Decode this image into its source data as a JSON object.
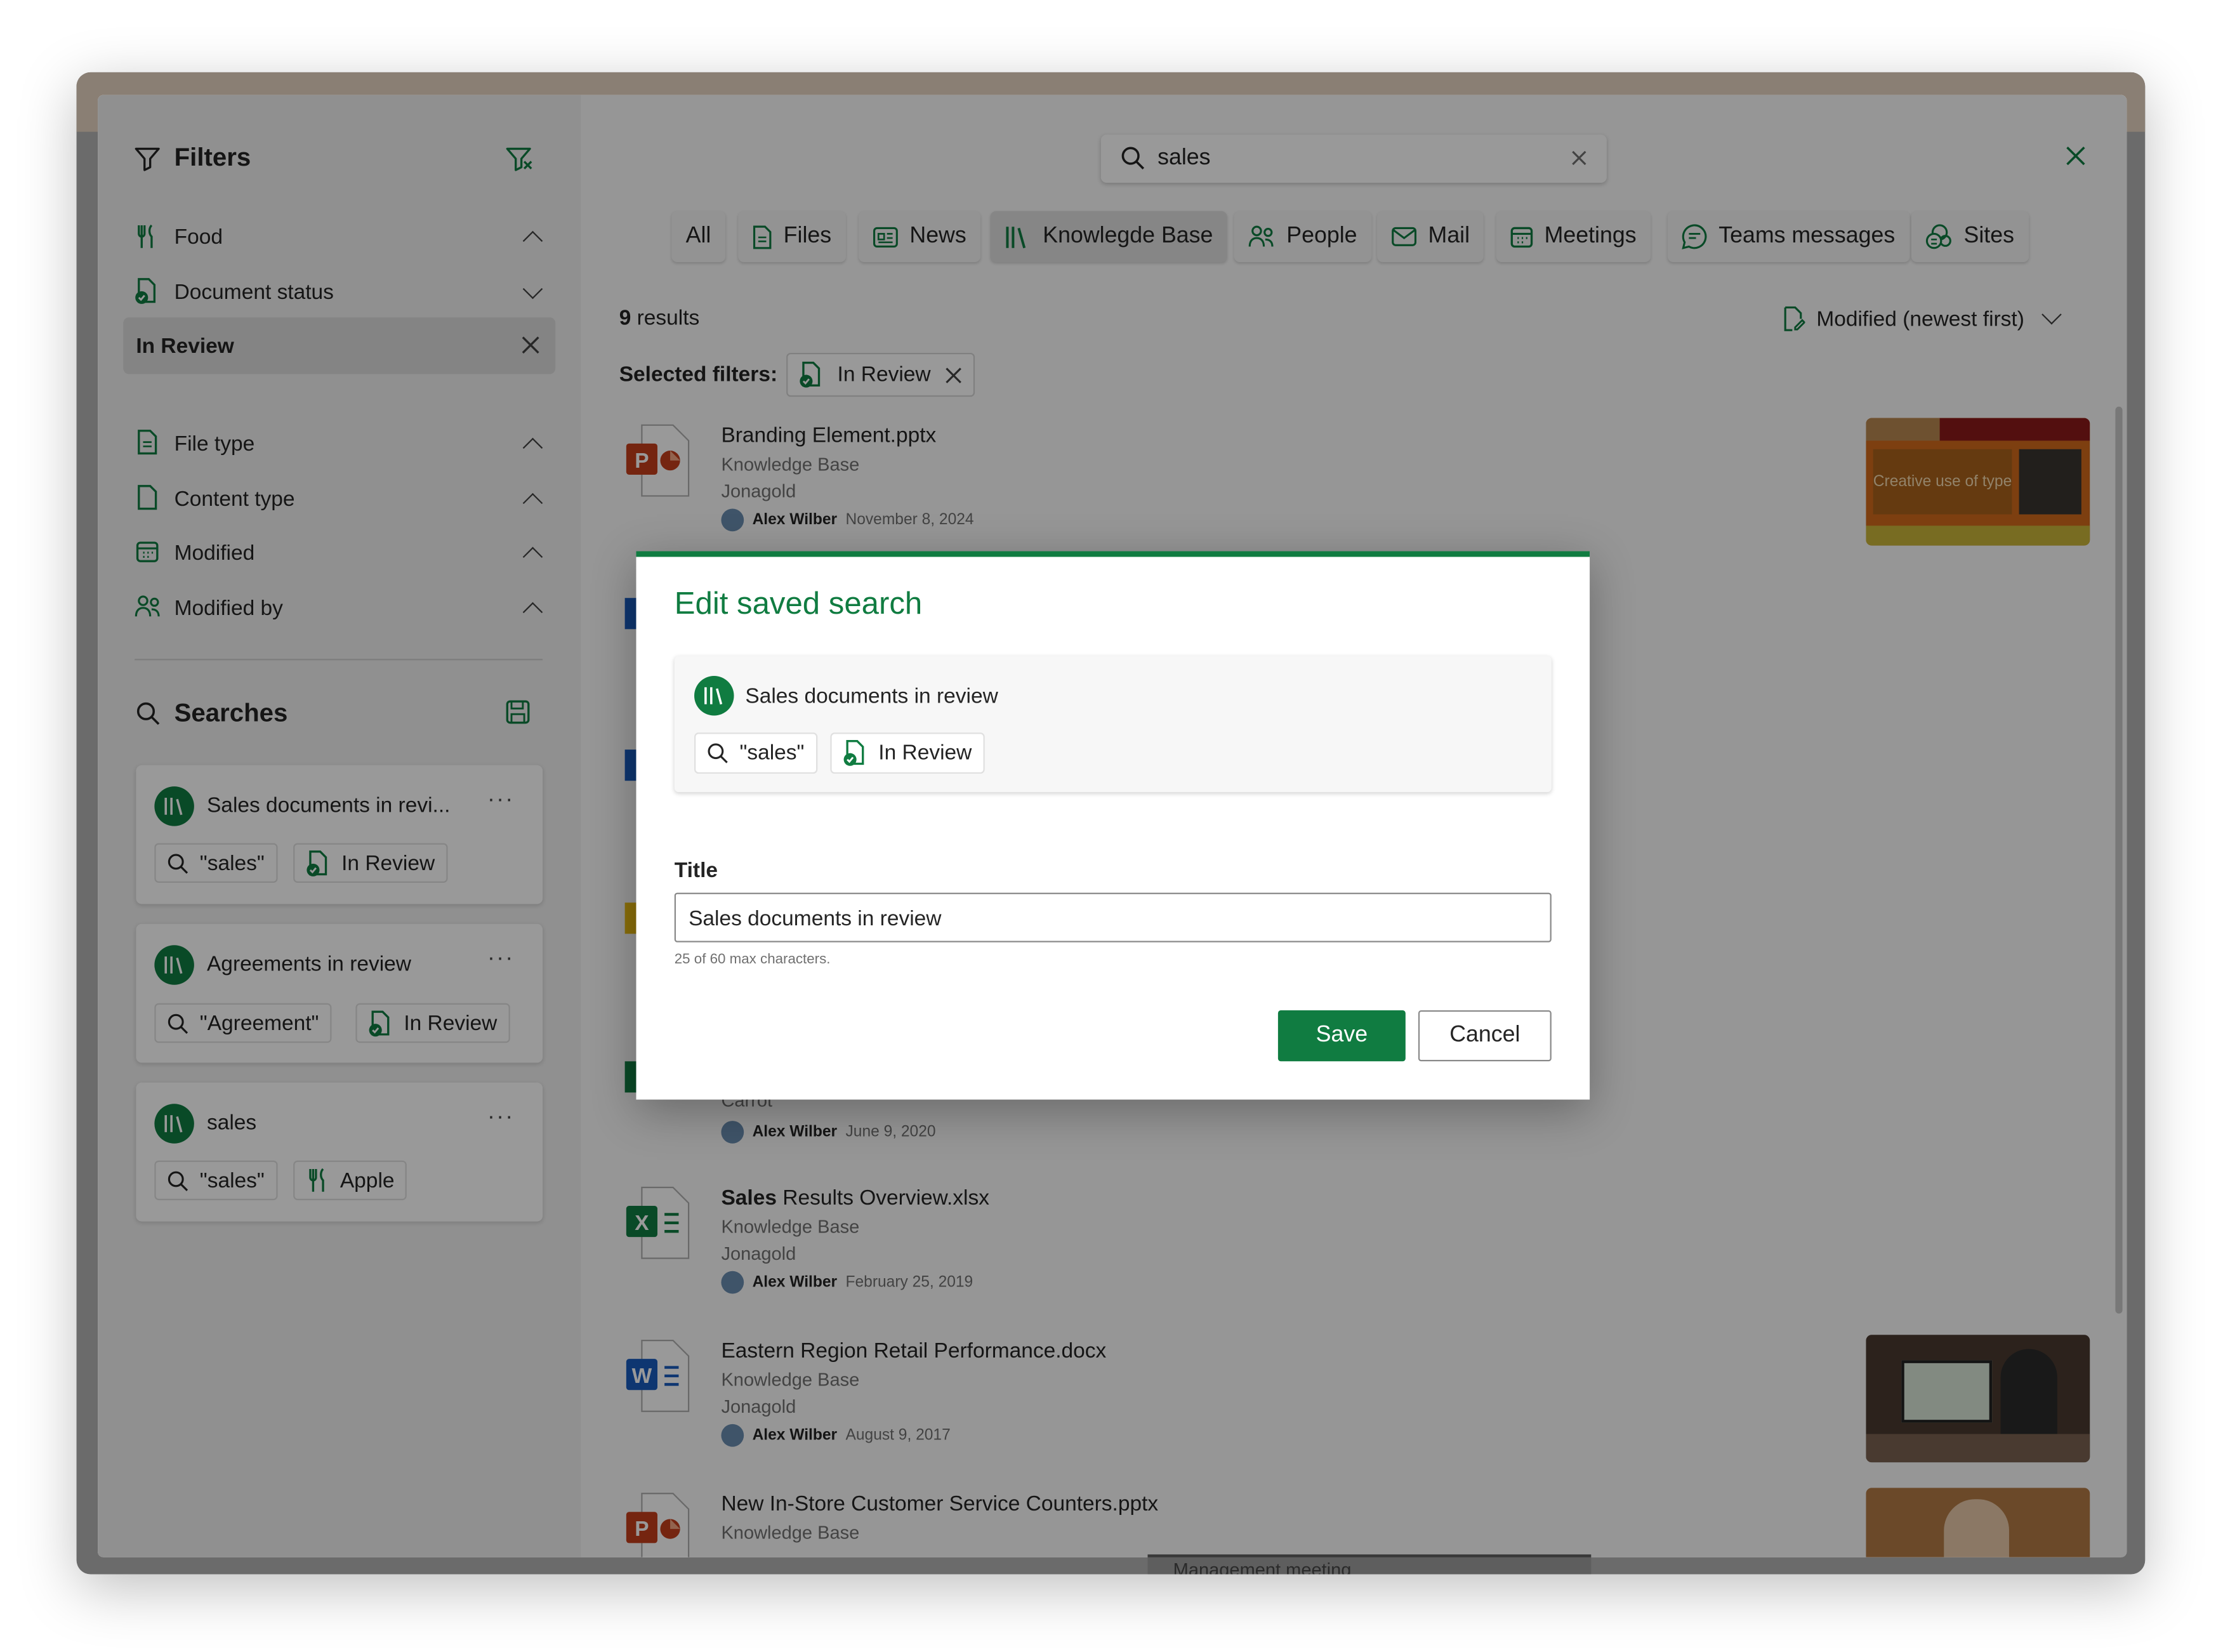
{
  "sidebar": {
    "title": "Filters",
    "filters": [
      {
        "label": "Food",
        "state": "up"
      },
      {
        "label": "Document status",
        "state": "down"
      }
    ],
    "selected_item": "In Review",
    "filters2": [
      {
        "label": "File type"
      },
      {
        "label": "Content type"
      },
      {
        "label": "Modified"
      },
      {
        "label": "Modified by"
      }
    ],
    "searches_title": "Searches",
    "saved": [
      {
        "title": "Sales documents in revi...",
        "query": "\"sales\"",
        "filter": "In Review"
      },
      {
        "title": "Agreements in review",
        "query": "\"Agreement\"",
        "filter": "In Review"
      },
      {
        "title": "sales",
        "query": "\"sales\"",
        "filter": "Apple"
      }
    ]
  },
  "search": {
    "value": "sales"
  },
  "tabs": [
    "All",
    "Files",
    "News",
    "Knowlegde Base",
    "People",
    "Mail",
    "Meetings",
    "Teams messages",
    "Sites"
  ],
  "results_header": {
    "count": "9",
    "suffix": "results",
    "sort": "Modified (newest first)"
  },
  "selected_filters": {
    "label": "Selected filters:",
    "chip": "In Review"
  },
  "results": [
    {
      "name": "Branding Element.pptx",
      "source": "Knowledge Base",
      "site": "Jonagold",
      "author": "Alex Wilber",
      "date": "November 8, 2024",
      "thumb_text": "Creative use of type"
    },
    {
      "partial": "Carrot",
      "author": "Alex Wilber",
      "date": "June 9, 2020"
    },
    {
      "name_bold": "Sales",
      "name_rest": " Results Overview.xlsx",
      "source": "Knowledge Base",
      "site": "Jonagold",
      "author": "Alex Wilber",
      "date": "February 25, 2019"
    },
    {
      "name": "Eastern Region Retail Performance.docx",
      "source": "Knowledge Base",
      "site": "Jonagold",
      "author": "Alex Wilber",
      "date": "August 9, 2017"
    },
    {
      "name": "New In-Store Customer Service Counters.pptx",
      "source": "Knowledge Base"
    }
  ],
  "behind_text": "Management meeting",
  "dialog": {
    "title": "Edit saved search",
    "preview_title": "Sales documents in review",
    "preview_query": "\"sales\"",
    "preview_filter": "In Review",
    "field_label": "Title",
    "field_value": "Sales documents in review",
    "char_count": "25 of 60 max characters.",
    "save": "Save",
    "cancel": "Cancel"
  },
  "colors": {
    "accent": "#107c41",
    "powerpoint": "#c43e1c",
    "word": "#185abd",
    "excel": "#107c41"
  }
}
